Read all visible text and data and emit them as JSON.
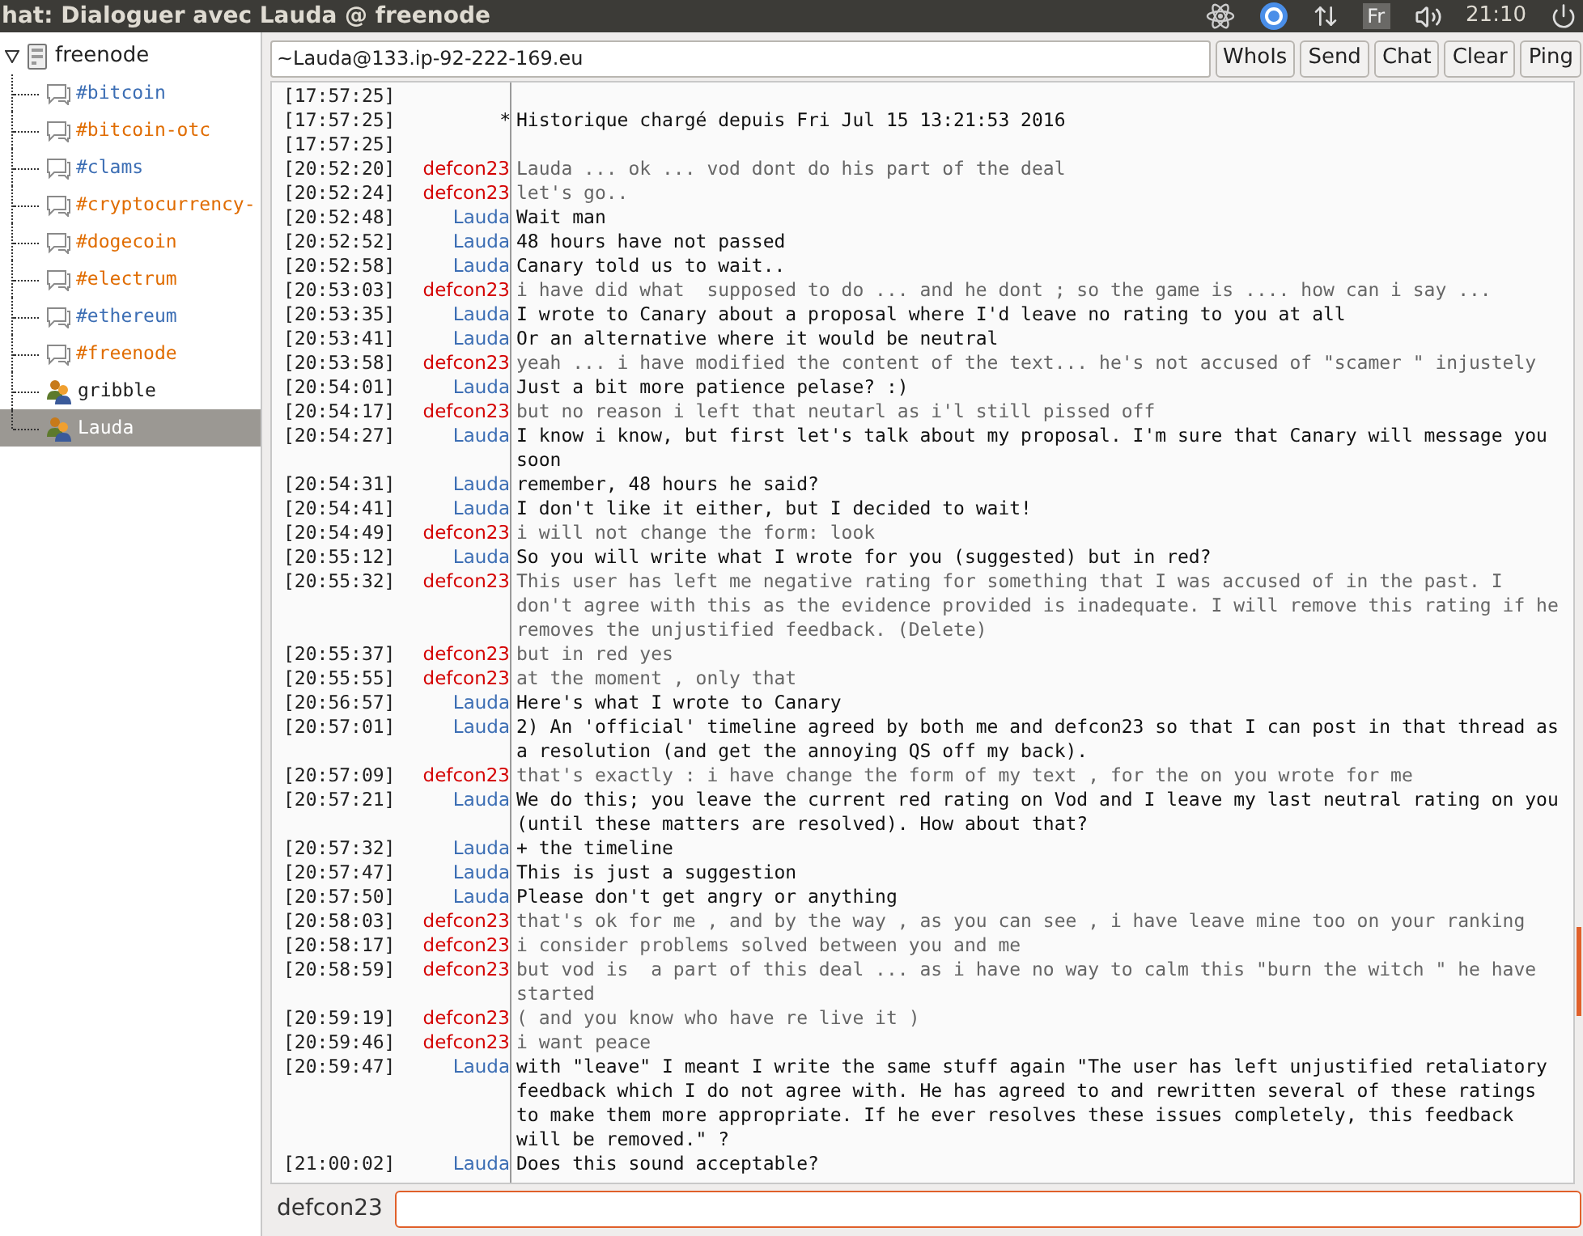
{
  "top_bar": {
    "title": "hat: Dialoguer avec Lauda @ freenode",
    "keyboard": "Fr",
    "clock": "21:10"
  },
  "sidebar": {
    "server": {
      "label": "freenode",
      "expanded": true
    },
    "items": [
      {
        "label": "#bitcoin",
        "kind": "channel",
        "color": "#3c6eb4",
        "selected": false
      },
      {
        "label": "#bitcoin-otc",
        "kind": "channel",
        "color": "#e06c00",
        "selected": false
      },
      {
        "label": "#clams",
        "kind": "channel",
        "color": "#3c6eb4",
        "selected": false
      },
      {
        "label": "#cryptocurrency-",
        "kind": "channel",
        "color": "#e06c00",
        "selected": false
      },
      {
        "label": "#dogecoin",
        "kind": "channel",
        "color": "#e06c00",
        "selected": false
      },
      {
        "label": "#electrum",
        "kind": "channel",
        "color": "#e06c00",
        "selected": false
      },
      {
        "label": "#ethereum",
        "kind": "channel",
        "color": "#3c6eb4",
        "selected": false
      },
      {
        "label": "#freenode",
        "kind": "channel",
        "color": "#e06c00",
        "selected": false
      },
      {
        "label": "gribble",
        "kind": "query",
        "color": "#1a1a1a",
        "selected": false
      },
      {
        "label": "Lauda",
        "kind": "query",
        "color": "#ffffff",
        "selected": true
      }
    ]
  },
  "host_field": {
    "value": "~Lauda@133.ip-92-222-169.eu"
  },
  "buttons": [
    "WhoIs",
    "Send",
    "Chat",
    "Clear",
    "Ping"
  ],
  "messages": [
    {
      "time": "[17:57:25]",
      "kind": "blank"
    },
    {
      "time": "[17:57:25]",
      "kind": "system",
      "nick": "*",
      "text": "Historique chargé depuis Fri Jul 15 13:21:53 2016"
    },
    {
      "time": "[17:57:25]",
      "kind": "blank"
    },
    {
      "time": "[20:52:20]",
      "kind": "self",
      "nick": "defcon23",
      "text": "Lauda ... ok ... vod dont do his part of the deal"
    },
    {
      "time": "[20:52:24]",
      "kind": "self",
      "nick": "defcon23",
      "text": "let's go.."
    },
    {
      "time": "[20:52:48]",
      "kind": "peer",
      "nick": "Lauda",
      "text": "Wait man"
    },
    {
      "time": "[20:52:52]",
      "kind": "peer",
      "nick": "Lauda",
      "text": "48 hours have not passed"
    },
    {
      "time": "[20:52:58]",
      "kind": "peer",
      "nick": "Lauda",
      "text": "Canary told us to wait.."
    },
    {
      "time": "[20:53:03]",
      "kind": "self",
      "nick": "defcon23",
      "text": "i have did what  supposed to do ... and he dont ; so the game is .... how can i say ..."
    },
    {
      "time": "[20:53:35]",
      "kind": "peer",
      "nick": "Lauda",
      "text": "I wrote to Canary about a proposal where I'd leave no rating to you at all"
    },
    {
      "time": "[20:53:41]",
      "kind": "peer",
      "nick": "Lauda",
      "text": "Or an alternative where it would be neutral"
    },
    {
      "time": "[20:53:58]",
      "kind": "self",
      "nick": "defcon23",
      "text": "yeah ... i have modified the content of the text... he's not accused of \"scamer \" injustely"
    },
    {
      "time": "[20:54:01]",
      "kind": "peer",
      "nick": "Lauda",
      "text": "Just a bit more patience pelase? :)"
    },
    {
      "time": "[20:54:17]",
      "kind": "self",
      "nick": "defcon23",
      "text": "but no reason i left that neutarl as i'l still pissed off"
    },
    {
      "time": "[20:54:27]",
      "kind": "peer",
      "nick": "Lauda",
      "text": "I know i know, but first let's talk about my proposal. I'm sure that Canary will message you soon"
    },
    {
      "time": "[20:54:31]",
      "kind": "peer",
      "nick": "Lauda",
      "text": "remember, 48 hours he said?"
    },
    {
      "time": "[20:54:41]",
      "kind": "peer",
      "nick": "Lauda",
      "text": "I don't like it either, but I decided to wait!"
    },
    {
      "time": "[20:54:49]",
      "kind": "self",
      "nick": "defcon23",
      "text": "i will not change the form: look"
    },
    {
      "time": "[20:55:12]",
      "kind": "peer",
      "nick": "Lauda",
      "text": "So you will write what I wrote for you (suggested) but in red?"
    },
    {
      "time": "[20:55:32]",
      "kind": "self",
      "nick": "defcon23",
      "text": "This user has left me negative rating for something that I was accused of in the past. I don't agree with this as the evidence provided is inadequate. I will remove this rating if he removes the unjustified feedback. (Delete)"
    },
    {
      "time": "[20:55:37]",
      "kind": "self",
      "nick": "defcon23",
      "text": "but in red yes"
    },
    {
      "time": "[20:55:55]",
      "kind": "self",
      "nick": "defcon23",
      "text": "at the moment , only that"
    },
    {
      "time": "[20:56:57]",
      "kind": "peer",
      "nick": "Lauda",
      "text": "Here's what I wrote to Canary"
    },
    {
      "time": "[20:57:01]",
      "kind": "peer",
      "nick": "Lauda",
      "text": "2) An 'official' timeline agreed by both me and defcon23 so that I can post in that thread as a resolution (and get the annoying QS off my back)."
    },
    {
      "time": "[20:57:09]",
      "kind": "self",
      "nick": "defcon23",
      "text": "that's exactly : i have change the form of my text , for the on you wrote for me"
    },
    {
      "time": "[20:57:21]",
      "kind": "peer",
      "nick": "Lauda",
      "text": "We do this; you leave the current red rating on Vod and I leave my last neutral rating on you (until these matters are resolved). How about that?"
    },
    {
      "time": "[20:57:32]",
      "kind": "peer",
      "nick": "Lauda",
      "text": "+ the timeline"
    },
    {
      "time": "[20:57:47]",
      "kind": "peer",
      "nick": "Lauda",
      "text": "This is just a suggestion"
    },
    {
      "time": "[20:57:50]",
      "kind": "peer",
      "nick": "Lauda",
      "text": "Please don't get angry or anything"
    },
    {
      "time": "[20:58:03]",
      "kind": "self",
      "nick": "defcon23",
      "text": "that's ok for me , and by the way , as you can see , i have leave mine too on your ranking"
    },
    {
      "time": "[20:58:17]",
      "kind": "self",
      "nick": "defcon23",
      "text": "i consider problems solved between you and me"
    },
    {
      "time": "[20:58:59]",
      "kind": "self",
      "nick": "defcon23",
      "text": "but vod is  a part of this deal ... as i have no way to calm this \"burn the witch \" he have started"
    },
    {
      "time": "[20:59:19]",
      "kind": "self",
      "nick": "defcon23",
      "text": "( and you know who have re live it )"
    },
    {
      "time": "[20:59:46]",
      "kind": "self",
      "nick": "defcon23",
      "text": "i want peace"
    },
    {
      "time": "[20:59:47]",
      "kind": "peer",
      "nick": "Lauda",
      "text": "with \"leave\" I meant I write the same stuff again \"The user has left unjustified retaliatory feedback which I do not agree with. He has agreed to and rewritten several of these ratings to make them more appropriate. If he ever resolves these issues completely, this feedback will be removed.\" ?"
    },
    {
      "time": "[21:00:02]",
      "kind": "peer",
      "nick": "Lauda",
      "text": "Does this sound acceptable?"
    }
  ],
  "input": {
    "nick": "defcon23"
  }
}
